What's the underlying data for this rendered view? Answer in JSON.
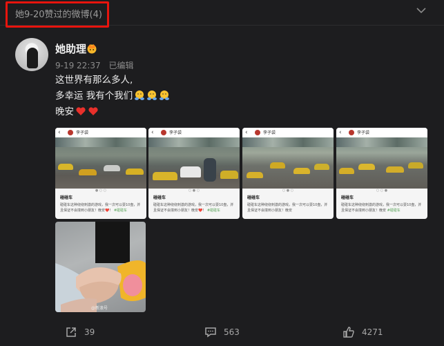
{
  "header": {
    "title": "她9-20赞过的微博(4)",
    "collapse_icon": "chevron-down-icon"
  },
  "post": {
    "author": "她助理",
    "badge_icon": "crown-badge-icon",
    "time": "9-19 22:37",
    "edited": "已编辑",
    "lines": [
      "这世界有那么多人,",
      "多幸运 我有个我们",
      "晚安"
    ],
    "images": [
      {
        "poster": "李子袋",
        "caption_title": "碰碰车",
        "caption_body": "碰碰车这种绕绕刺激的游戏，我一次可以耍10盘，并且保证不会撞到小朋友！晚安❤️！",
        "tag": "#碰碰车"
      },
      {
        "poster": "李子袋",
        "caption_title": "碰碰车",
        "caption_body": "碰碰车这种绕绕刺激的游戏，我一次可以耍10盘，并且保证不会撞到小朋友！晚安❤️！",
        "tag": "#碰碰车"
      },
      {
        "poster": "李子袋",
        "caption_title": "碰碰车",
        "caption_body": "碰碰车这种绕绕刺激的游戏，我一次可以耍10盘，并且保证不会撞到小朋友！晚安",
        "tag": "#碰碰车"
      },
      {
        "poster": "李子袋",
        "caption_title": "碰碰车",
        "caption_body": "碰碰车这种绕绕刺激的游戏，我一次可以耍10盘，并且保证不会撞到小朋友！晚安",
        "tag": "#碰碰车"
      }
    ],
    "image5_watermark": "@新浪号"
  },
  "actions": {
    "share_count": "39",
    "comment_count": "563",
    "like_count": "4271"
  },
  "colors": {
    "background": "#1d1d1f",
    "highlight": "#e8140d",
    "heart": "#e8302b"
  }
}
